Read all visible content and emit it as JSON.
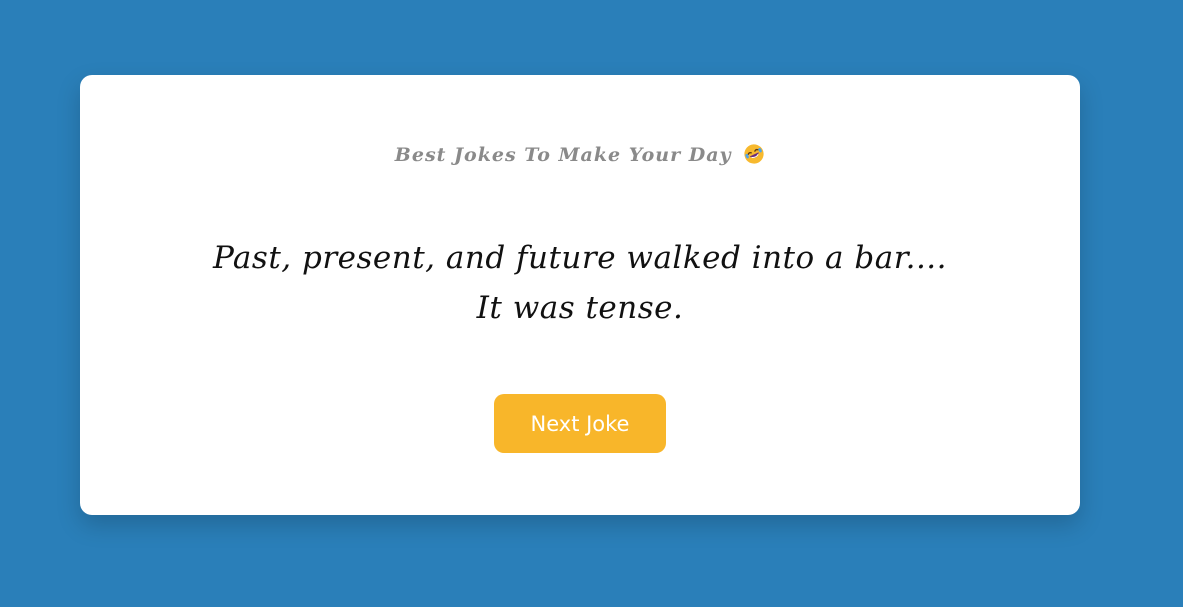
{
  "colors": {
    "background": "#2a7fb9",
    "card": "#ffffff",
    "heading": "#8a8a8a",
    "joke_text": "#111111",
    "button": "#f8b62a",
    "button_text": "#ffffff"
  },
  "card": {
    "heading": "Best Jokes To Make Your Day",
    "heading_icon": "rolling-on-floor-laughing-emoji",
    "joke": "Past, present, and future walked into a bar.... It was tense.",
    "button_label": "Next Joke"
  }
}
